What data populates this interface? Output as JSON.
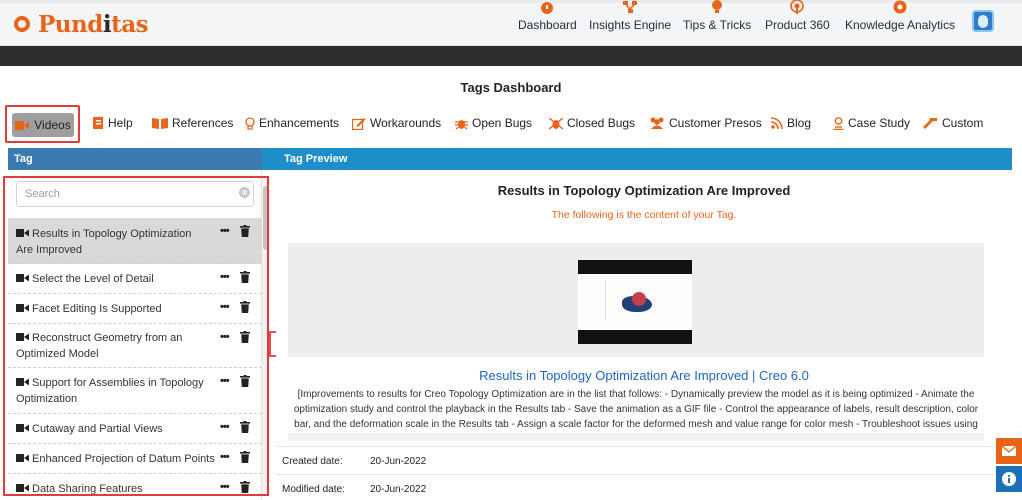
{
  "brand": {
    "name_part1": "Pund",
    "name_part2": "i",
    "name_part3": "tas"
  },
  "topnav": [
    {
      "label": "Dashboard",
      "icon": "dashboard-icon",
      "color": "#e8641b"
    },
    {
      "label": "Insights Engine",
      "icon": "network-icon",
      "color": "#e8641b"
    },
    {
      "label": "Tips & Tricks",
      "icon": "lightbulb-icon",
      "color": "#e8641b"
    },
    {
      "label": "Product 360",
      "icon": "broadcast-icon",
      "color": "#e8641b"
    },
    {
      "label": "Knowledge Analytics",
      "icon": "analytics-icon",
      "color": "#e8641b"
    }
  ],
  "page_title": "Tags Dashboard",
  "tabs": [
    {
      "label": "Videos",
      "icon": "video-camera-icon",
      "active": true
    },
    {
      "label": "Help",
      "icon": "help-book-icon"
    },
    {
      "label": "References",
      "icon": "open-book-icon"
    },
    {
      "label": "Enhancements",
      "icon": "bulb-outline-icon"
    },
    {
      "label": "Workarounds",
      "icon": "edit-icon"
    },
    {
      "label": "Open Bugs",
      "icon": "bug-icon"
    },
    {
      "label": "Closed Bugs",
      "icon": "bug-crossed-icon"
    },
    {
      "label": "Customer Presos",
      "icon": "users-icon"
    },
    {
      "label": "Blog",
      "icon": "rss-icon"
    },
    {
      "label": "Case Study",
      "icon": "person-icon"
    },
    {
      "label": "Custom",
      "icon": "wrench-icon"
    }
  ],
  "panel_headers": {
    "left": "Tag",
    "right": "Tag Preview"
  },
  "search": {
    "placeholder": "Search",
    "clear_glyph": "⊗"
  },
  "tag_list": [
    {
      "label": "Results in Topology Optimization Are Improved",
      "selected": true
    },
    {
      "label": "Select the Level of Detail"
    },
    {
      "label": "Facet Editing Is Supported"
    },
    {
      "label": "Reconstruct Geometry from an Optimized Model"
    },
    {
      "label": "Support for Assemblies in Topology Optimization"
    },
    {
      "label": "Cutaway and Partial Views"
    },
    {
      "label": "Enhanced Projection of Datum Points"
    },
    {
      "label": "Data Sharing Features"
    }
  ],
  "list_actions": {
    "more": "•••"
  },
  "preview": {
    "title": "Results in Topology Optimization Are Improved",
    "subtitle": "The following is the content of your Tag.",
    "link": "Results in Topology Optimization Are Improved | Creo 6.0",
    "body": "[Improvements to results for Creo Topology Optimization are in the list that follows: - Dynamically preview the model as it is being optimized - Animate the optimization study and control the playback in the Results tab - Save the animation as a GIF file - Control the appearance of labels, result description, color bar, and the deformation scale in the Results tab - Assign a scale factor for the deformed mesh and value range for color mesh - Troubleshoot issues using improved",
    "meta": [
      {
        "key": "Created date:",
        "value": "20-Jun-2022"
      },
      {
        "key": "Modified date:",
        "value": "20-Jun-2022"
      }
    ]
  },
  "colors": {
    "accent": "#e8641b",
    "band": "#1d8ec7",
    "highlight_frame": "#e23b3b",
    "link": "#1f66c2"
  }
}
